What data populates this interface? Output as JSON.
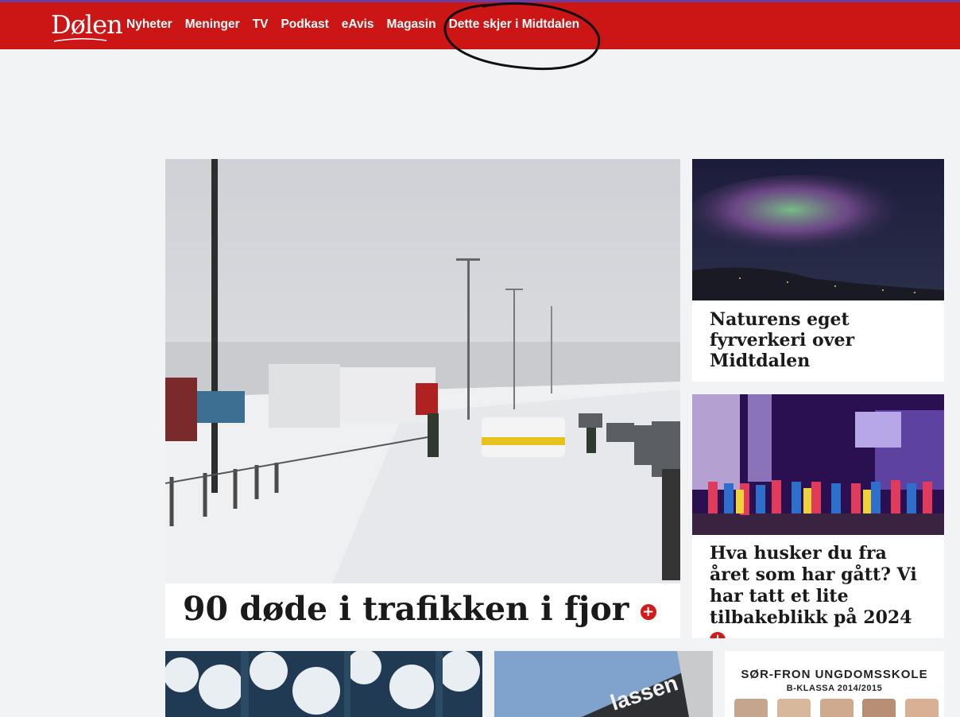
{
  "header": {
    "logo_text": "Dølen",
    "nav": [
      "Nyheter",
      "Meninger",
      "TV",
      "Podkast",
      "eAvis",
      "Magasin",
      "Dette skjer i Midtdalen"
    ],
    "brand_color": "#cc1515"
  },
  "main_story": {
    "headline": "90 døde i trafikken i fjor",
    "badge": "+",
    "image_icon": "snow-traffic-accident-photo"
  },
  "side_story_1": {
    "headline": "Naturens eget fyrverkeri over Midtdalen",
    "image_icon": "northern-lights-photo"
  },
  "side_story_2": {
    "headline": "Hva husker du fra året som har gått? Vi har tatt et lite tilbakeblikk på 2024",
    "badge": "+",
    "image_icon": "school-choir-stage-photo"
  },
  "bottom_teasers": {
    "teaser_3": {
      "title": "SØR-FRON UNGDOMSSKOLE",
      "subtitle": "B-KLASSA 2014/2015"
    }
  }
}
